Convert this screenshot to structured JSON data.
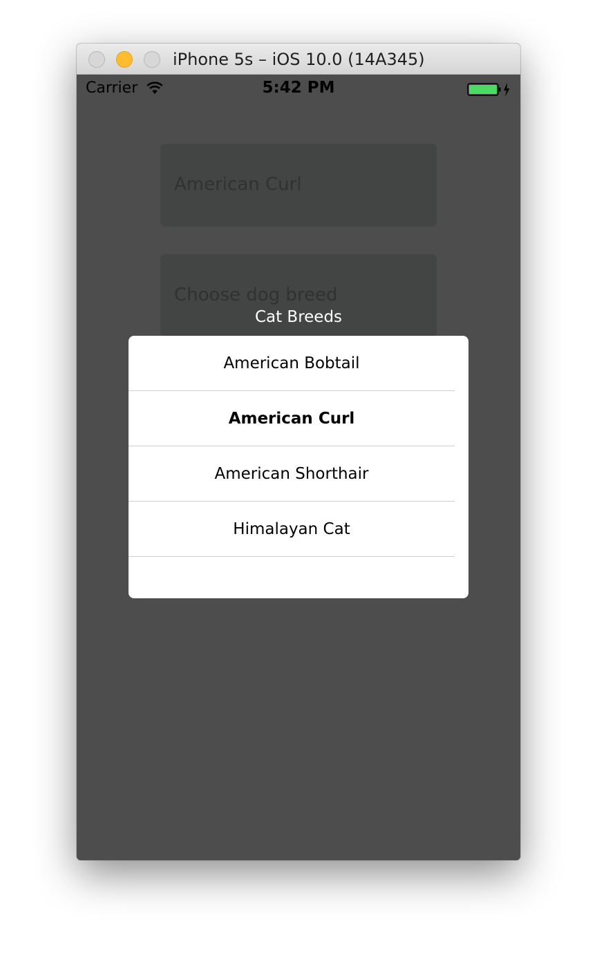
{
  "window": {
    "title": "iPhone 5s – iOS 10.0 (14A345)"
  },
  "status_bar": {
    "carrier": "Carrier",
    "time": "5:42 PM",
    "battery_color": "#4cd964"
  },
  "form": {
    "cat_field_value": "American Curl",
    "dog_field_placeholder": "Choose dog breed"
  },
  "picker": {
    "title": "Cat Breeds",
    "items": [
      {
        "label": "American Bobtail",
        "selected": false
      },
      {
        "label": "American Curl",
        "selected": true
      },
      {
        "label": "American Shorthair",
        "selected": false
      },
      {
        "label": "Himalayan Cat",
        "selected": false
      }
    ]
  },
  "colors": {
    "overlay": "#4d4d4d",
    "field_bg": "#434545",
    "picker_bg": "#ffffff",
    "minimize_button": "#ffbd2e"
  }
}
